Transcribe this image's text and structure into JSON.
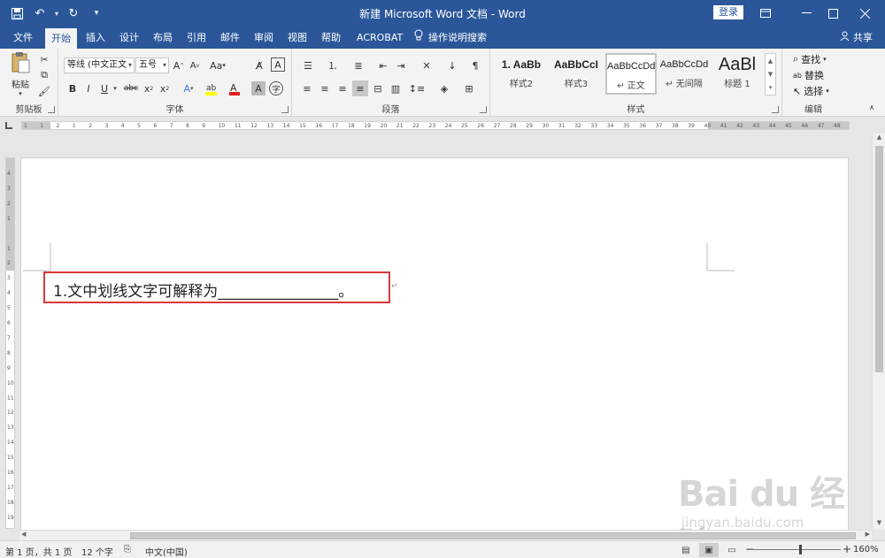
{
  "titlebar": {
    "title": "新建 Microsoft Word 文档 - Word",
    "login": "登录",
    "qat": {
      "save": "save-icon",
      "undo": "undo-icon",
      "redo": "redo-icon",
      "customize": "customize-icon"
    }
  },
  "tabs": {
    "items": [
      "文件",
      "开始",
      "插入",
      "设计",
      "布局",
      "引用",
      "邮件",
      "审阅",
      "视图",
      "帮助",
      "ACROBAT"
    ],
    "active": "开始",
    "tell_me": "操作说明搜索",
    "share": "共享"
  },
  "ribbon": {
    "clipboard": {
      "label": "剪贴板",
      "paste": "粘贴"
    },
    "font": {
      "label": "字体",
      "font_name": "等线 (中文正文",
      "font_size": "五号",
      "aa": "Aa"
    },
    "paragraph": {
      "label": "段落"
    },
    "styles": {
      "label": "样式",
      "items": [
        {
          "sample": "1.  AaBb",
          "name": "样式2"
        },
        {
          "sample": "AaBbCcI",
          "name": "样式3"
        },
        {
          "sample": "AaBbCcDd",
          "name": "↵ 正文"
        },
        {
          "sample": "AaBbCcDd",
          "name": "↵ 无间隔"
        },
        {
          "sample": "AaBl",
          "name": "标题 1"
        }
      ]
    },
    "editing": {
      "label": "编辑",
      "find": "查找",
      "replace": "替换",
      "select": "选择"
    }
  },
  "ruler": {
    "labels": [
      "1",
      "1",
      "2",
      "1",
      "2",
      "3",
      "4",
      "5",
      "6",
      "7",
      "8",
      "9",
      "10",
      "11",
      "12",
      "13",
      "14",
      "15",
      "16",
      "17",
      "18",
      "19",
      "20",
      "21",
      "22",
      "23",
      "24",
      "25",
      "26",
      "27",
      "28",
      "29",
      "30",
      "31",
      "32",
      "33",
      "34",
      "35",
      "36",
      "37",
      "38",
      "39",
      "40",
      "41",
      "42",
      "43",
      "44",
      "45",
      "46",
      "47",
      "48"
    ],
    "vlabels": [
      "4",
      "3",
      "2",
      "1",
      "",
      "1",
      "2",
      "3",
      "4",
      "5",
      "6",
      "7",
      "8",
      "9",
      "10",
      "11",
      "12",
      "13",
      "14",
      "15",
      "16",
      "17",
      "18",
      "19",
      "10"
    ]
  },
  "document": {
    "sentence": "1.文中划线文字可解释为________________。",
    "para_mark": "↵"
  },
  "watermark": {
    "line1": "Bai du 经验",
    "line2": "jingyan.baidu.com"
  },
  "status": {
    "page": "第 1 页，共 1 页",
    "words": "12 个字",
    "language": "中文(中国)",
    "zoom": "160%",
    "minus": "−",
    "plus": "+"
  }
}
